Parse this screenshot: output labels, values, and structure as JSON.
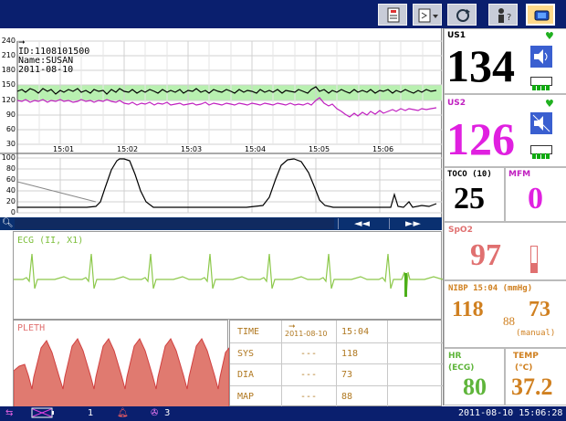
{
  "toolbar": {
    "icons": [
      "book-icon",
      "menu-dropdown-icon",
      "refresh-icon",
      "person-help-icon",
      "monitor-icon"
    ]
  },
  "fetal": {
    "patient_id": "ID:1108101500",
    "patient_name": "Name:SUSAN",
    "patient_date": "2011-08-10",
    "fhr_axis": [
      "240",
      "210",
      "180",
      "150",
      "120",
      "90",
      "60",
      "30"
    ],
    "toco_axis": [
      "100",
      "80",
      "60",
      "40",
      "20",
      "0"
    ],
    "time_labels": [
      "15:01",
      "15:02",
      "15:03",
      "15:04",
      "15:05",
      "15:06"
    ]
  },
  "scroll": {
    "back": "◄◄",
    "forward": "►►"
  },
  "ecg": {
    "label": "ECG    (II, X1)"
  },
  "pleth": {
    "label": "PLETH"
  },
  "nibp_table": {
    "rows": [
      {
        "label": "TIME",
        "date": "2011-08-10",
        "value": "15:04"
      },
      {
        "label": "SYS",
        "date": "---",
        "value": "118"
      },
      {
        "label": "DIA",
        "date": "---",
        "value": "73"
      },
      {
        "label": "MAP",
        "date": "---",
        "value": "88"
      }
    ]
  },
  "us1": {
    "label": "US1",
    "value": "134"
  },
  "us2": {
    "label": "US2",
    "value": "126"
  },
  "toco": {
    "label": "TOCO  (10)",
    "value": "25"
  },
  "mfm": {
    "label": "MFM",
    "value": "0"
  },
  "spo2": {
    "label": "SpO2",
    "value": "97"
  },
  "nibp": {
    "label": "NIBP 15:04  (mmHg)",
    "sys": "118",
    "dia": "73",
    "map": "88",
    "mode": "(manual)"
  },
  "hr": {
    "label": "HR",
    "sub": "(ECG)",
    "value": "80"
  },
  "temp": {
    "label": "TEMP",
    "sub": "(°C)",
    "value": "37.2"
  },
  "status": {
    "bed": "1",
    "alarm_count": "3",
    "datetime": "2011-08-10 15:06:28"
  },
  "colors": {
    "fhr1": "#000000",
    "fhr2": "#c020c0",
    "band": "#b8f0b0",
    "ecg": "#8cc84a",
    "pleth": "#e07070",
    "nibp": "#d08020",
    "hr": "#5fb53b",
    "temp": "#d08020",
    "spo2": "#e07070"
  }
}
